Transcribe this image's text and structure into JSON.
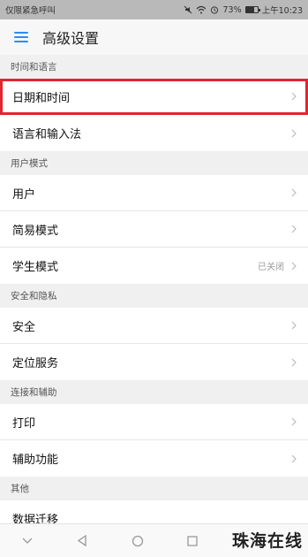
{
  "status_bar": {
    "left_text": "仅限紧急呼叫",
    "battery": "73%",
    "time": "上午10:23",
    "icons": [
      "mute-icon",
      "wifi-icon",
      "alarm-icon",
      "battery-icon"
    ]
  },
  "app_bar": {
    "title": "高级设置",
    "menu_icon": "menu-icon"
  },
  "sections": {
    "time_lang": {
      "header": "时间和语言",
      "items": [
        {
          "label": "日期和时间"
        },
        {
          "label": "语言和输入法"
        }
      ]
    },
    "user_mode": {
      "header": "用户模式",
      "items": [
        {
          "label": "用户"
        },
        {
          "label": "简易模式"
        },
        {
          "label": "学生模式",
          "value": "已关闭"
        }
      ]
    },
    "security": {
      "header": "安全和隐私",
      "items": [
        {
          "label": "安全"
        },
        {
          "label": "定位服务"
        }
      ]
    },
    "connect": {
      "header": "连接和辅助",
      "items": [
        {
          "label": "打印"
        },
        {
          "label": "辅助功能"
        }
      ]
    },
    "other": {
      "header": "其他",
      "items": [
        {
          "label": "数据迁移"
        }
      ]
    }
  },
  "nav": {
    "icons": [
      "down-icon",
      "back-icon",
      "home-icon",
      "recents-icon"
    ]
  },
  "watermark": "珠海在线",
  "colors": {
    "accent": "#2d8cf0",
    "highlight": "#e0262e"
  }
}
